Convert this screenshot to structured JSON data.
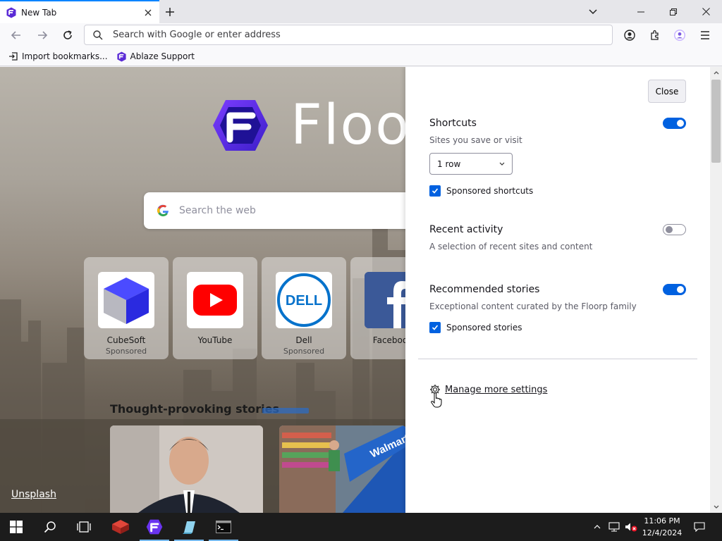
{
  "tab": {
    "title": "New Tab"
  },
  "navbar": {
    "url_placeholder": "Search with Google or enter address"
  },
  "bookmarks": [
    {
      "label": "Import bookmarks..."
    },
    {
      "label": "Ablaze Support"
    }
  ],
  "newtab": {
    "brand": "Floorp",
    "search_placeholder": "Search the web",
    "shortcuts": [
      {
        "label": "CubeSoft",
        "sub": "Sponsored"
      },
      {
        "label": "YouTube",
        "sub": ""
      },
      {
        "label": "Dell",
        "sub": "Sponsored"
      },
      {
        "label": "Facebook",
        "sub": ""
      }
    ],
    "stories_heading": "Thought-provoking stories",
    "unsplash": "Unsplash"
  },
  "panel": {
    "close_label": "Close",
    "shortcuts": {
      "title": "Shortcuts",
      "desc": "Sites you save or visit",
      "enabled": true,
      "rows": "1 row",
      "sponsored_label": "Sponsored shortcuts",
      "sponsored_checked": true
    },
    "recent": {
      "title": "Recent activity",
      "desc": "A selection of recent sites and content",
      "enabled": false
    },
    "stories": {
      "title": "Recommended stories",
      "desc": "Exceptional content curated by the Floorp family",
      "enabled": true,
      "sponsored_label": "Sponsored stories",
      "sponsored_checked": true
    },
    "manage_label": "Manage more settings"
  },
  "taskbar": {
    "time": "11:06 PM",
    "date": "12/4/2024"
  },
  "colors": {
    "accent": "#0061e0",
    "floorp_purple": "#5b2bd6",
    "tab_highlight": "#0a84ff"
  }
}
